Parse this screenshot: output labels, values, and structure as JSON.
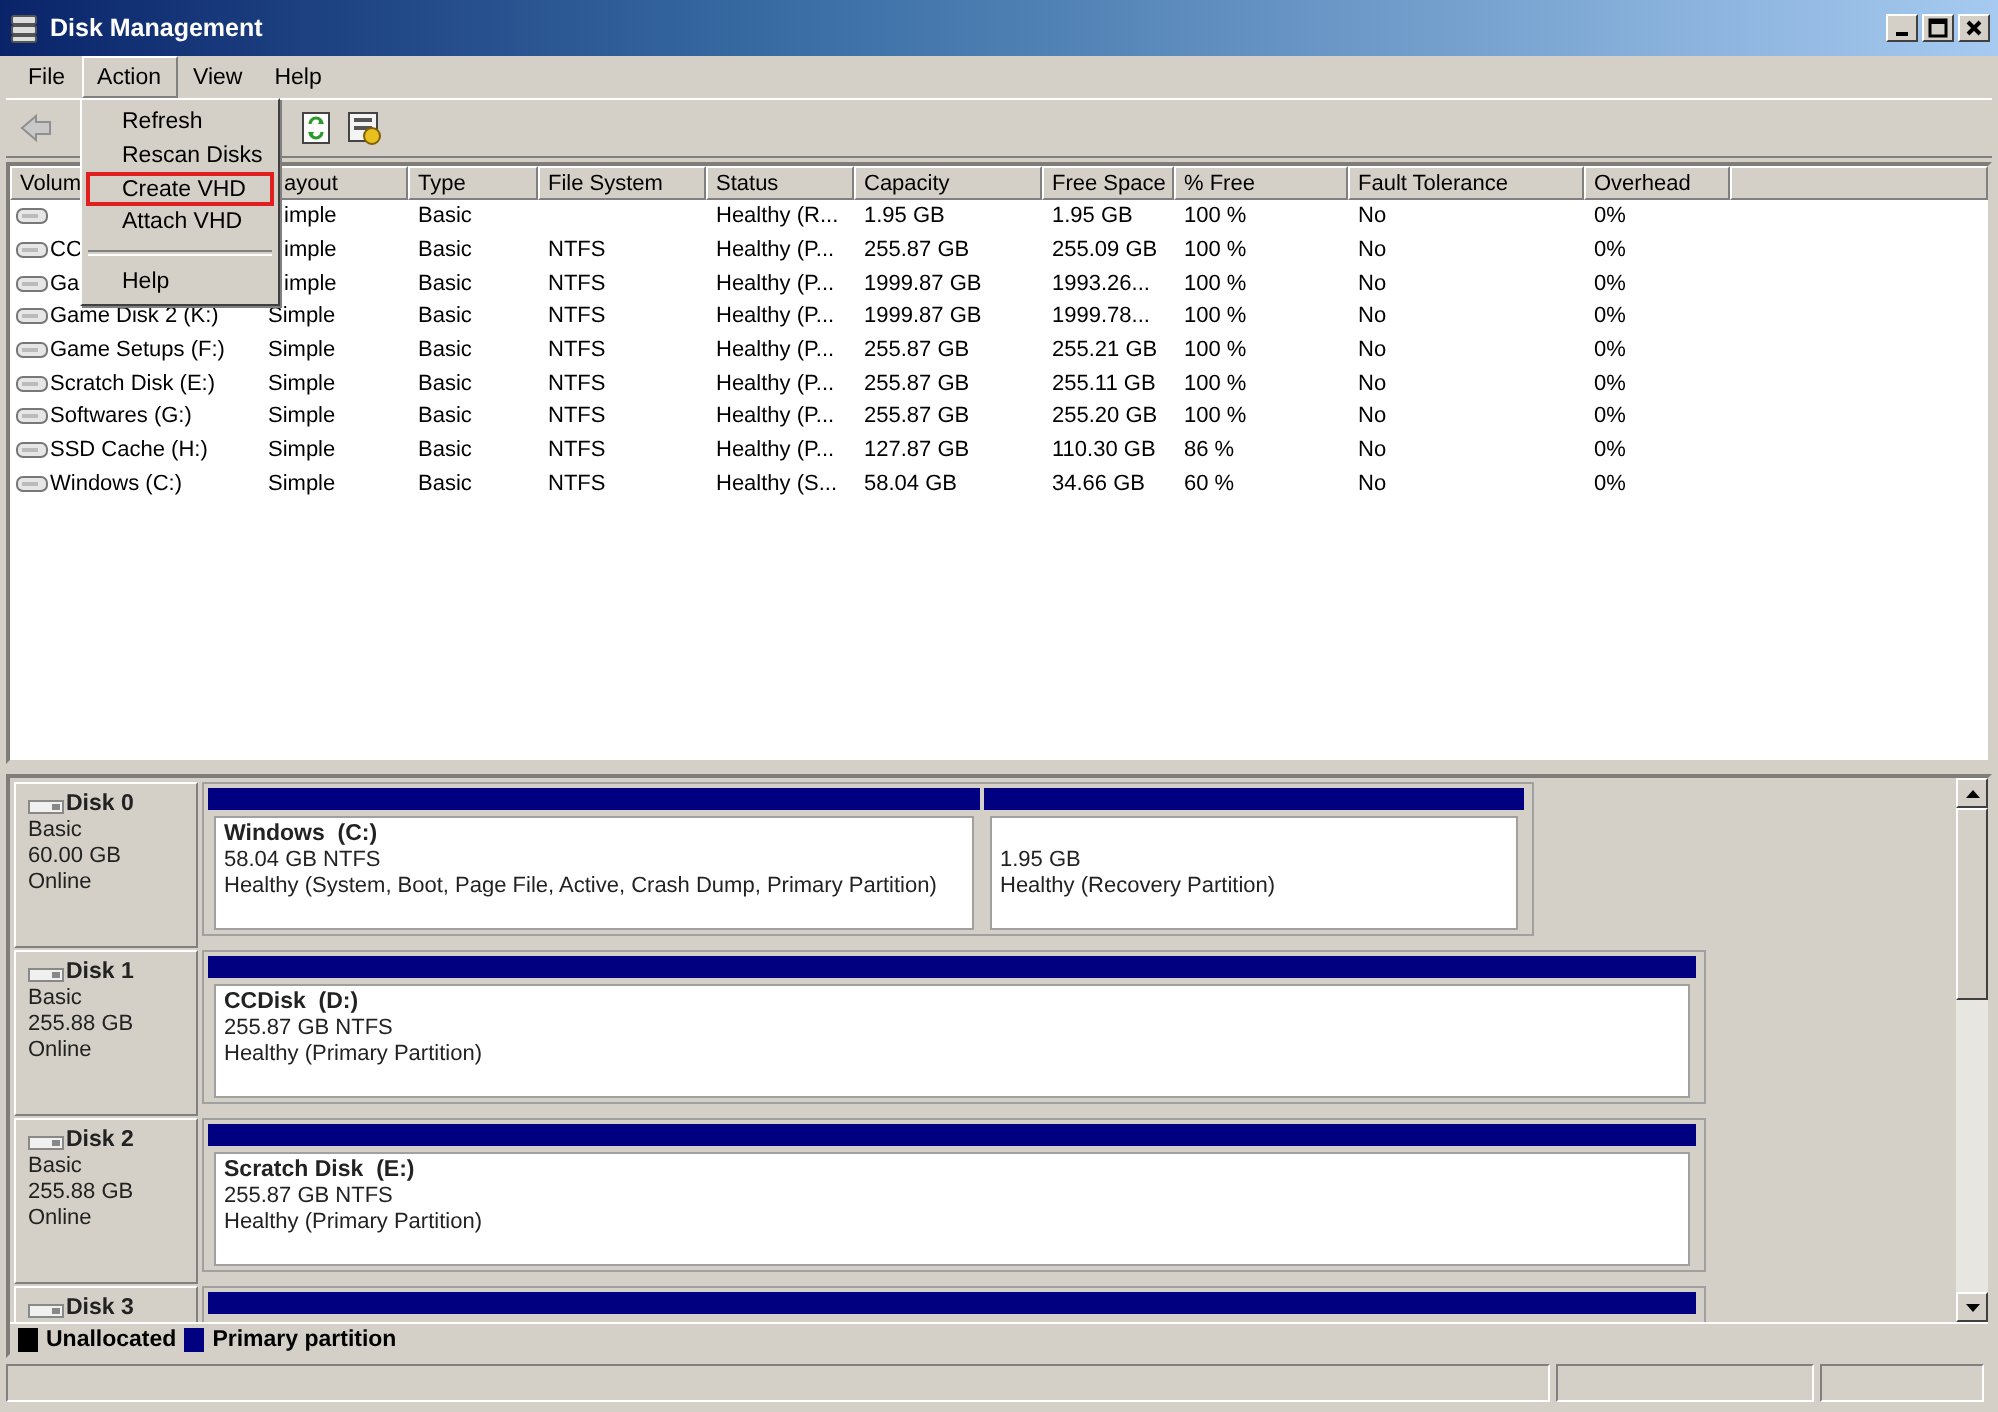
{
  "window": {
    "title": "Disk Management"
  },
  "menus": [
    {
      "label": "File",
      "selected": false
    },
    {
      "label": "Action",
      "selected": true
    },
    {
      "label": "View",
      "selected": false
    },
    {
      "label": "Help",
      "selected": false
    }
  ],
  "open_menu": {
    "items": [
      {
        "kind": "item",
        "label": "Refresh",
        "outlined": false
      },
      {
        "kind": "item",
        "label": "Rescan Disks",
        "outlined": false
      },
      {
        "kind": "item",
        "label": "Create VHD",
        "outlined": true
      },
      {
        "kind": "item",
        "label": "Attach VHD",
        "outlined": false
      },
      {
        "kind": "separator"
      },
      {
        "kind": "item",
        "label": "Help",
        "outlined": false
      }
    ]
  },
  "table": {
    "columns": [
      "Volum",
      "ayout",
      "Type",
      "File System",
      "Status",
      "Capacity",
      "Free Space",
      "% Free",
      "Fault Tolerance",
      "Overhead"
    ],
    "rows": [
      [
        "",
        "imple",
        "Basic",
        "",
        "Healthy (R...",
        "1.95 GB",
        "1.95 GB",
        "100 %",
        "No",
        "0%"
      ],
      [
        "CC",
        "imple",
        "Basic",
        "NTFS",
        "Healthy (P...",
        "255.87 GB",
        "255.09 GB",
        "100 %",
        "No",
        "0%"
      ],
      [
        "Ga",
        "imple",
        "Basic",
        "NTFS",
        "Healthy (P...",
        "1999.87 GB",
        "1993.26...",
        "100 %",
        "No",
        "0%"
      ],
      [
        "Game Disk 2 (K:)",
        "Simple",
        "Basic",
        "NTFS",
        "Healthy (P...",
        "1999.87 GB",
        "1999.78...",
        "100 %",
        "No",
        "0%"
      ],
      [
        "Game Setups (F:)",
        "Simple",
        "Basic",
        "NTFS",
        "Healthy (P...",
        "255.87 GB",
        "255.21 GB",
        "100 %",
        "No",
        "0%"
      ],
      [
        "Scratch Disk (E:)",
        "Simple",
        "Basic",
        "NTFS",
        "Healthy (P...",
        "255.87 GB",
        "255.11 GB",
        "100 %",
        "No",
        "0%"
      ],
      [
        "Softwares (G:)",
        "Simple",
        "Basic",
        "NTFS",
        "Healthy (P...",
        "255.87 GB",
        "255.20 GB",
        "100 %",
        "No",
        "0%"
      ],
      [
        "SSD Cache (H:)",
        "Simple",
        "Basic",
        "NTFS",
        "Healthy (P...",
        "127.87 GB",
        "110.30 GB",
        "86 %",
        "No",
        "0%"
      ],
      [
        "Windows (C:)",
        "Simple",
        "Basic",
        "NTFS",
        "Healthy (S...",
        "58.04 GB",
        "34.66 GB",
        "60 %",
        "No",
        "0%"
      ]
    ]
  },
  "disks": [
    {
      "name": "Disk 0",
      "type": "Basic",
      "size": "60.00 GB",
      "status": "Online",
      "partitions": [
        {
          "kind": "primary",
          "label": "Windows  (C:)",
          "detail": "58.04 GB NTFS",
          "status": "Healthy (System, Boot, Page File, Active, Crash Dump, Primary Partition)"
        },
        {
          "kind": "primary",
          "detail": "1.95 GB",
          "status": "Healthy (Recovery Partition)"
        }
      ]
    },
    {
      "name": "Disk 1",
      "type": "Basic",
      "size": "255.88 GB",
      "status": "Online",
      "partitions": [
        {
          "kind": "primary",
          "label": "CCDisk  (D:)",
          "detail": "255.87 GB NTFS",
          "status": "Healthy (Primary Partition)"
        }
      ]
    },
    {
      "name": "Disk 2",
      "type": "Basic",
      "size": "255.88 GB",
      "status": "Online",
      "partitions": [
        {
          "kind": "primary",
          "label": "Scratch Disk  (E:)",
          "detail": "255.87 GB NTFS",
          "status": "Healthy (Primary Partition)"
        }
      ]
    },
    {
      "name": "Disk 3",
      "partitions": [
        {
          "kind": "primary"
        }
      ]
    }
  ],
  "legend": [
    {
      "label": "Unallocated",
      "color": "#000000"
    },
    {
      "label": "Primary partition",
      "color": "#000080"
    }
  ]
}
